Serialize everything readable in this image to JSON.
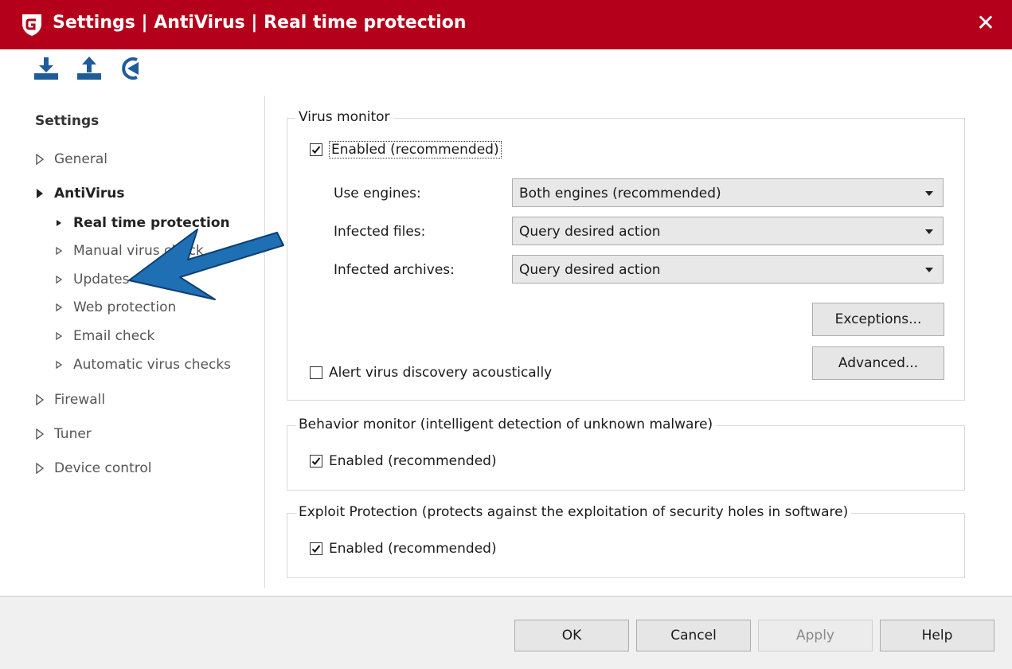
{
  "window": {
    "title": "Settings | AntiVirus | Real time protection",
    "close_icon": "close-icon",
    "brand_color": "#b5001b"
  },
  "toolbar": {
    "icons": [
      "import-icon",
      "export-icon",
      "reset-icon"
    ],
    "icon_color": "#1f5c99"
  },
  "nav": {
    "heading": "Settings",
    "items": [
      {
        "label": "General",
        "level": 0,
        "expanded": false
      },
      {
        "label": "AntiVirus",
        "level": 0,
        "expanded": true
      },
      {
        "label": "Real time protection",
        "level": 1,
        "selected": true
      },
      {
        "label": "Manual virus check",
        "level": 1
      },
      {
        "label": "Updates",
        "level": 1
      },
      {
        "label": "Web protection",
        "level": 1
      },
      {
        "label": "Email check",
        "level": 1
      },
      {
        "label": "Automatic virus checks",
        "level": 1
      },
      {
        "label": "Firewall",
        "level": 0
      },
      {
        "label": "Tuner",
        "level": 0
      },
      {
        "label": "Device control",
        "level": 0
      }
    ]
  },
  "annotation": {
    "arrow_color": "#1f6fb5"
  },
  "virus_monitor": {
    "legend": "Virus monitor",
    "enabled_label": "Enabled (recommended)",
    "enabled_checked": true,
    "engines_label": "Use engines:",
    "engines_value": "Both engines (recommended)",
    "infected_files_label": "Infected files:",
    "infected_files_value": "Query desired action",
    "infected_archives_label": "Infected archives:",
    "infected_archives_value": "Query desired action",
    "exceptions_label": "Exceptions...",
    "advanced_label": "Advanced...",
    "alert_label": "Alert virus discovery acoustically",
    "alert_checked": false
  },
  "behavior_monitor": {
    "legend": "Behavior monitor (intelligent detection of unknown malware)",
    "enabled_label": "Enabled (recommended)",
    "enabled_checked": true
  },
  "exploit_protection": {
    "legend": "Exploit Protection (protects against the exploitation of security holes in software)",
    "enabled_label": "Enabled (recommended)",
    "enabled_checked": true
  },
  "footer": {
    "ok": "OK",
    "cancel": "Cancel",
    "apply": "Apply",
    "apply_enabled": false,
    "help": "Help"
  }
}
